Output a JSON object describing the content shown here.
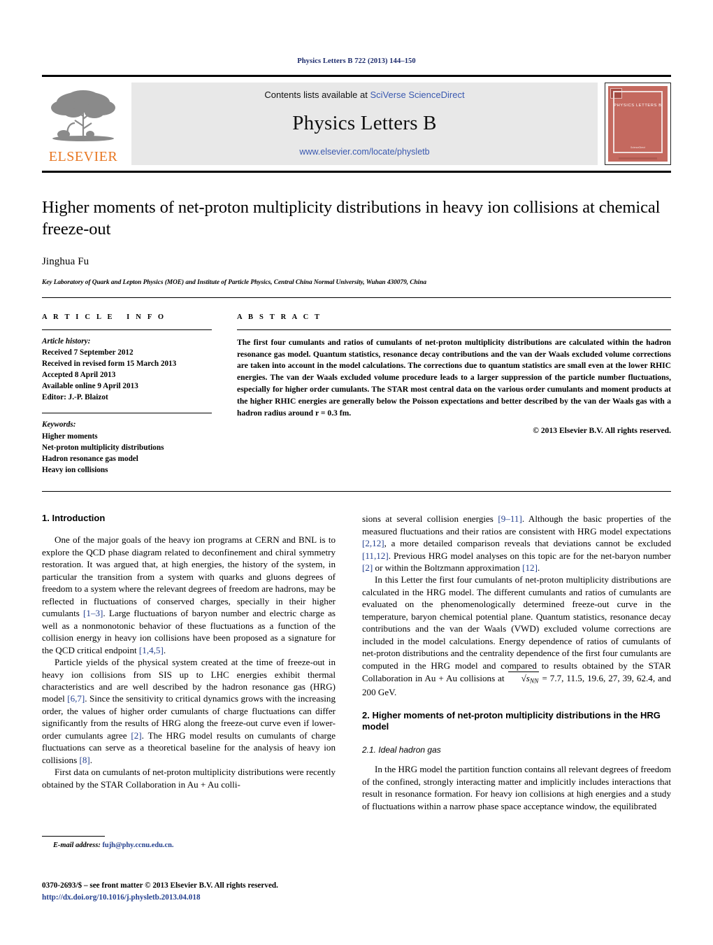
{
  "running_head": "Physics Letters B 722 (2013) 144–150",
  "masthead": {
    "contents_prefix": "Contents lists available at ",
    "contents_link": "SciVerse ScienceDirect",
    "journal_name": "Physics Letters B",
    "journal_url": "www.elsevier.com/locate/physletb",
    "publisher_wordmark": "ELSEVIER",
    "cover_title": "PHYSICS LETTERS B",
    "cover_footer": "ScienceDirect",
    "accent_orange": "#e87722",
    "link_blue": "#3a59b0",
    "cover_red": "#c4695f",
    "running_head_color": "#1b2a6b"
  },
  "article": {
    "title": "Higher moments of net-proton multiplicity distributions in heavy ion collisions at chemical freeze-out",
    "author": "Jinghua Fu",
    "affiliation": "Key Laboratory of Quark and Lepton Physics (MOE) and Institute of Particle Physics, Central China Normal University, Wuhan 430079, China"
  },
  "article_info": {
    "heading": "ARTICLE INFO",
    "history_label": "Article history:",
    "history": [
      "Received 7 September 2012",
      "Received in revised form 15 March 2013",
      "Accepted 8 April 2013",
      "Available online 9 April 2013",
      "Editor: J.-P. Blaizot"
    ],
    "keywords_label": "Keywords:",
    "keywords": [
      "Higher moments",
      "Net-proton multiplicity distributions",
      "Hadron resonance gas model",
      "Heavy ion collisions"
    ]
  },
  "abstract": {
    "heading": "ABSTRACT",
    "text": "The first four cumulants and ratios of cumulants of net-proton multiplicity distributions are calculated within the hadron resonance gas model. Quantum statistics, resonance decay contributions and the van der Waals excluded volume corrections are taken into account in the model calculations. The corrections due to quantum statistics are small even at the lower RHIC energies. The van der Waals excluded volume procedure leads to a larger suppression of the particle number fluctuations, especially for higher order cumulants. The STAR most central data on the various order cumulants and moment products at the higher RHIC energies are generally below the Poisson expectations and better described by the van der Waals gas with a hadron radius around r = 0.3 fm.",
    "copyright": "© 2013 Elsevier B.V. All rights reserved."
  },
  "body": {
    "left": {
      "section_heading": "1. Introduction",
      "paragraphs": [
        "One of the major goals of the heavy ion programs at CERN and BNL is to explore the QCD phase diagram related to deconfinement and chiral symmetry restoration. It was argued that, at high energies, the history of the system, in particular the transition from a system with quarks and gluons degrees of freedom to a system where the relevant degrees of freedom are hadrons, may be reflected in fluctuations of conserved charges, specially in their higher cumulants [1–3]. Large fluctuations of baryon number and electric charge as well as a nonmonotonic behavior of these fluctuations as a function of the collision energy in heavy ion collisions have been proposed as a signature for the QCD critical endpoint [1,4,5].",
        "Particle yields of the physical system created at the time of freeze-out in heavy ion collisions from SIS up to LHC energies exhibit thermal characteristics and are well described by the hadron resonance gas (HRG) model [6,7]. Since the sensitivity to critical dynamics grows with the increasing order, the values of higher order cumulants of charge fluctuations can differ significantly from the results of HRG along the freeze-out curve even if lower-order cumulants agree [2]. The HRG model results on cumulants of charge fluctuations can serve as a theoretical baseline for the analysis of heavy ion collisions [8].",
        "First data on cumulants of net-proton multiplicity distributions were recently obtained by the STAR Collaboration in Au + Au colli-"
      ]
    },
    "right": {
      "paragraphs": [
        "sions at several collision energies [9–11]. Although the basic properties of the measured fluctuations and their ratios are consistent with HRG model expectations [2,12], a more detailed comparison reveals that deviations cannot be excluded [11,12]. Previous HRG model analyses on this topic are for the net-baryon number [2] or within the Boltzmann approximation [12].",
        "In this Letter the first four cumulants of net-proton multiplicity distributions are calculated in the HRG model. The different cumulants and ratios of cumulants are evaluated on the phenomenologically determined freeze-out curve in the temperature, baryon chemical potential plane. Quantum statistics, resonance decay contributions and the van der Waals (VWD) excluded volume corrections are included in the model calculations. Energy dependence of ratios of cumulants of net-proton distributions and the centrality dependence of the first four cumulants are computed in the HRG model and compared to results obtained by the STAR Collaboration in Au + Au collisions at √sNN = 7.7, 11.5, 19.6, 27, 39, 62.4, and 200 GeV."
      ],
      "section_heading": "2. Higher moments of net-proton multiplicity distributions in the HRG model",
      "subsection_heading": "2.1. Ideal hadron gas",
      "paragraph_after": "In the HRG model the partition function contains all relevant degrees of freedom of the confined, strongly interacting matter and implicitly includes interactions that result in resonance formation. For heavy ion collisions at high energies and a study of fluctuations within a narrow phase space acceptance window, the equilibrated"
    }
  },
  "footnote": {
    "label": "E-mail address:",
    "email": "fujh@phy.ccnu.edu.cn."
  },
  "footer": {
    "front_matter": "0370-2693/$ – see front matter © 2013 Elsevier B.V. All rights reserved.",
    "doi": "http://dx.doi.org/10.1016/j.physletb.2013.04.018"
  }
}
